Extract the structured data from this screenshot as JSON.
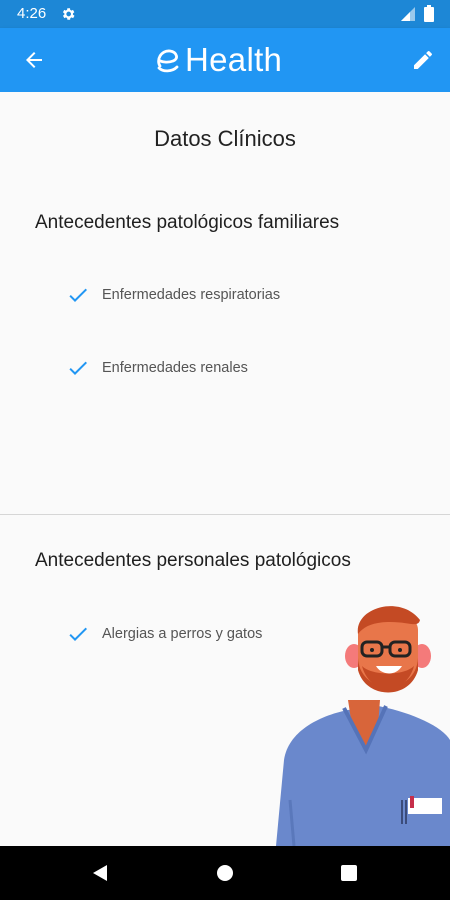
{
  "status_bar": {
    "time": "4:26",
    "icons": [
      "gear-icon",
      "signal-icon",
      "battery-icon"
    ]
  },
  "app_bar": {
    "logo_text": "Health",
    "back_icon": "arrow-back-icon",
    "edit_icon": "pencil-icon",
    "background_color": "#2196f3"
  },
  "page": {
    "title": "Datos Clínicos"
  },
  "sections": [
    {
      "title": "Antecedentes patológicos familiares",
      "items": [
        "Enfermedades respiratorias",
        "Enfermedades renales"
      ]
    },
    {
      "title": "Antecedentes personales patológicos",
      "items": [
        "Alergias a perros y gatos"
      ]
    }
  ],
  "colors": {
    "accent": "#2196f3",
    "check": "#2196f3"
  },
  "nav_bar": {
    "icons": [
      "nav-back-icon",
      "nav-home-icon",
      "nav-recents-icon"
    ]
  }
}
